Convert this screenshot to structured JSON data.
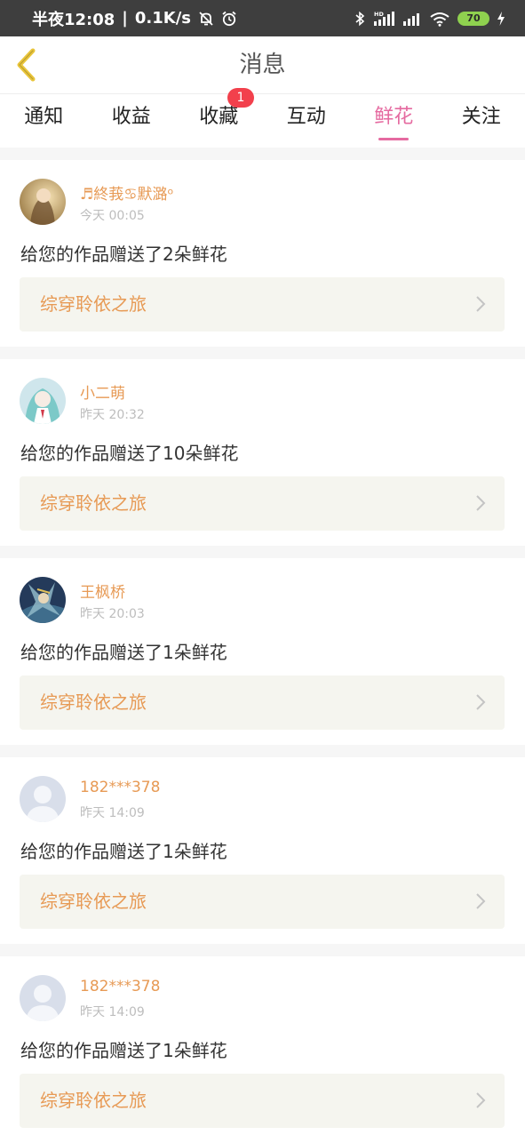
{
  "status_bar": {
    "time": "半夜12:08",
    "network_speed": "0.1K/s",
    "battery": "70",
    "hd_label": "HD",
    "icons": [
      "bell-off-icon",
      "alarm-icon",
      "bluetooth-icon",
      "signal-icon",
      "signal-icon",
      "wifi-icon",
      "battery-icon",
      "charging-icon"
    ]
  },
  "header": {
    "title": "消息",
    "back_icon": "chevron-left-icon"
  },
  "tabs": [
    {
      "label": "通知"
    },
    {
      "label": "收益"
    },
    {
      "label": "收藏",
      "badge": "1"
    },
    {
      "label": "互动"
    },
    {
      "label": "鲜花",
      "active": true
    },
    {
      "label": "关注"
    }
  ],
  "messages": [
    {
      "user": "♬終莪♋默潞ᵒ",
      "time": "今天 00:05",
      "text": "给您的作品赠送了2朵鲜花",
      "work": "综穿聆依之旅",
      "avatar": "avatar-icon"
    },
    {
      "user": "小二萌",
      "time": "昨天 20:32",
      "text": "给您的作品赠送了10朵鲜花",
      "work": "综穿聆依之旅",
      "avatar": "avatar-icon"
    },
    {
      "user": "王枫桥",
      "time": "昨天 20:03",
      "text": "给您的作品赠送了1朵鲜花",
      "work": "综穿聆依之旅",
      "avatar": "avatar-icon"
    },
    {
      "user": "182***378",
      "time": "昨天 14:09",
      "text": "给您的作品赠送了1朵鲜花",
      "work": "综穿聆依之旅",
      "avatar": "default-avatar-icon"
    },
    {
      "user": "182***378",
      "time": "昨天 14:09",
      "text": "给您的作品赠送了1朵鲜花",
      "work": "综穿聆依之旅",
      "avatar": "default-avatar-icon"
    }
  ],
  "colors": {
    "accent_pink": "#e56aa0",
    "username_orange": "#e79a55",
    "badge_red": "#f2404c",
    "back_arrow_yellow": "#e9c53a",
    "status_bar_bg": "#3e3e3e"
  }
}
